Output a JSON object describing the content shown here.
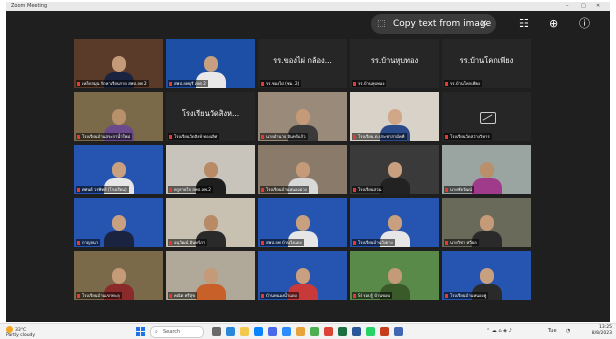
{
  "window": {
    "title": "Zoom Meeting",
    "controls": {
      "minimize": "–",
      "maximize": "□",
      "close": "✕"
    }
  },
  "overlay": {
    "copy_text_label": "Copy text from image",
    "copy_icon": "text-select-icon",
    "close_icon": "close-icon",
    "settings_icon": "sliders-icon",
    "zoom_icon": "magnify-icon",
    "info_icon": "info-icon"
  },
  "participants": [
    {
      "name": "เหล็กสมุน รักหาเรียนราย สพป.ลพ 2",
      "type": "video",
      "bg": "#5a3b2a",
      "skin": "#c49a78",
      "shirt": "#1a2440",
      "active": true
    },
    {
      "name": "สพป.ลพบุรี เขต 2",
      "type": "video",
      "bg": "#1e4fa6",
      "skin": "#c8a080",
      "shirt": "#e8e8e8"
    },
    {
      "name": "รร.ชองไผ่ (ชม. 2)",
      "bigname": "รร.ของไผ่ กล้อง...",
      "type": "name",
      "bg": "#262626"
    },
    {
      "name": "รร.บ้านหุบทอง",
      "bigname": "รร.บ้านหุบทอง",
      "type": "name",
      "bg": "#262626"
    },
    {
      "name": "รร.บ้านโคกเพียง",
      "bigname": "รร.บ้านโคกเพียง",
      "type": "name",
      "bg": "#262626"
    },
    {
      "name": "โรงเรียนบ้านสระกาน้ำใหม่",
      "type": "video",
      "bg": "#7a6a4a",
      "skin": "#b8906c",
      "shirt": "#6a4a8a"
    },
    {
      "name": "โรงเรียนวัดสิงห์ ทองเลิศ",
      "bigname": "โรงเรียนวัดสิงห...",
      "type": "name",
      "bg": "#262626"
    },
    {
      "name": "นายอำนาจ อินทร์แก้ว",
      "type": "video",
      "bg": "#9a8a7a",
      "skin": "#c49a78",
      "shirt": "#3a3a3a"
    },
    {
      "name": "โรงเรียน ต.ประชาสามัคคี",
      "type": "video",
      "bg": "#d8d2c8",
      "skin": "#d0a888",
      "shirt": "#2a4a8a"
    },
    {
      "name": "โรงเรียนวัดสว่างวิหาร",
      "type": "camoff",
      "bg": "#262626"
    },
    {
      "name": "ศศนย์ วรพิทย์ (โรงเรียน)",
      "type": "video",
      "bg": "#2555b0",
      "skin": "#c8a080",
      "shirt": "#e6e6e6"
    },
    {
      "name": "ครูสายใจ สพป.ลพ.2",
      "type": "video",
      "bg": "#c8c4bc",
      "skin": "#b88a66",
      "shirt": "#1e1e1e"
    },
    {
      "name": "โรงเรียนบ้านหนองม่วง",
      "type": "video",
      "bg": "#8a7a6a",
      "skin": "#c49a78",
      "shirt": "#d8d8d8"
    },
    {
      "name": "โรงเรียนสวน",
      "type": "video",
      "bg": "#3a3a3a",
      "skin": "#c8a080",
      "shirt": "#222"
    },
    {
      "name": "นายชัยวัฒน์",
      "type": "video",
      "bg": "#9aa4a0",
      "skin": "#b8906c",
      "shirt": "#a03a8a"
    },
    {
      "name": "กาญจนา",
      "type": "video",
      "bg": "#2555b0",
      "skin": "#c8a080",
      "shirt": "#1a2440"
    },
    {
      "name": "อนุวัฒน์ อินทร์ภา",
      "type": "video",
      "bg": "#c8c0b0",
      "skin": "#b88a66",
      "shirt": "#2a2a2a"
    },
    {
      "name": "สพป.ลพ บ้านวังแดง",
      "type": "video",
      "bg": "#2555b0",
      "skin": "#c8a080",
      "shirt": "#e6e6e6"
    },
    {
      "name": "โรงเรียนบ้านวังยาง",
      "type": "video",
      "bg": "#2555b0",
      "skin": "#c8a080",
      "shirt": "#e6e6e6"
    },
    {
      "name": "นายวิชา ทวีผล",
      "type": "video",
      "bg": "#6a6a5a",
      "skin": "#c49a78",
      "shirt": "#2a2a2a"
    },
    {
      "name": "โรงเรียนบ้านเขาทะลุ",
      "type": "video",
      "bg": "#7a6a4a",
      "skin": "#c49a78",
      "shirt": "#8a2a2a"
    },
    {
      "name": "คณิต ศรีสุข",
      "type": "video",
      "bg": "#b0a898",
      "skin": "#c49a78",
      "shirt": "#c8602a"
    },
    {
      "name": "บ้านหนองน้ำแดง",
      "type": "video",
      "bg": "#2555b0",
      "skin": "#c8a080",
      "shirt": "#c83a3a"
    },
    {
      "name": "SI รอบรู้ บ้านขอบ",
      "type": "video",
      "bg": "#5a8a4a",
      "skin": "#c49a78",
      "shirt": "#3a5a2a"
    },
    {
      "name": "โรงเรียนบ้านหนองคู่",
      "type": "video",
      "bg": "#2555b0",
      "skin": "#c8a080",
      "shirt": "#2a2a2a"
    }
  ],
  "taskbar": {
    "weather_temp": "33°C",
    "weather_desc": "Partly cloudy",
    "weather_icon": "sun-cloud-icon",
    "search_placeholder": "Search",
    "search_icon": "search-icon",
    "tray_text": "Tue",
    "time": "13:25",
    "date": "8/8/2023"
  },
  "colors": {
    "active_speaker": "#c9d34a",
    "mute_indicator": "#e53935",
    "window_bg": "#1f1f1f"
  }
}
